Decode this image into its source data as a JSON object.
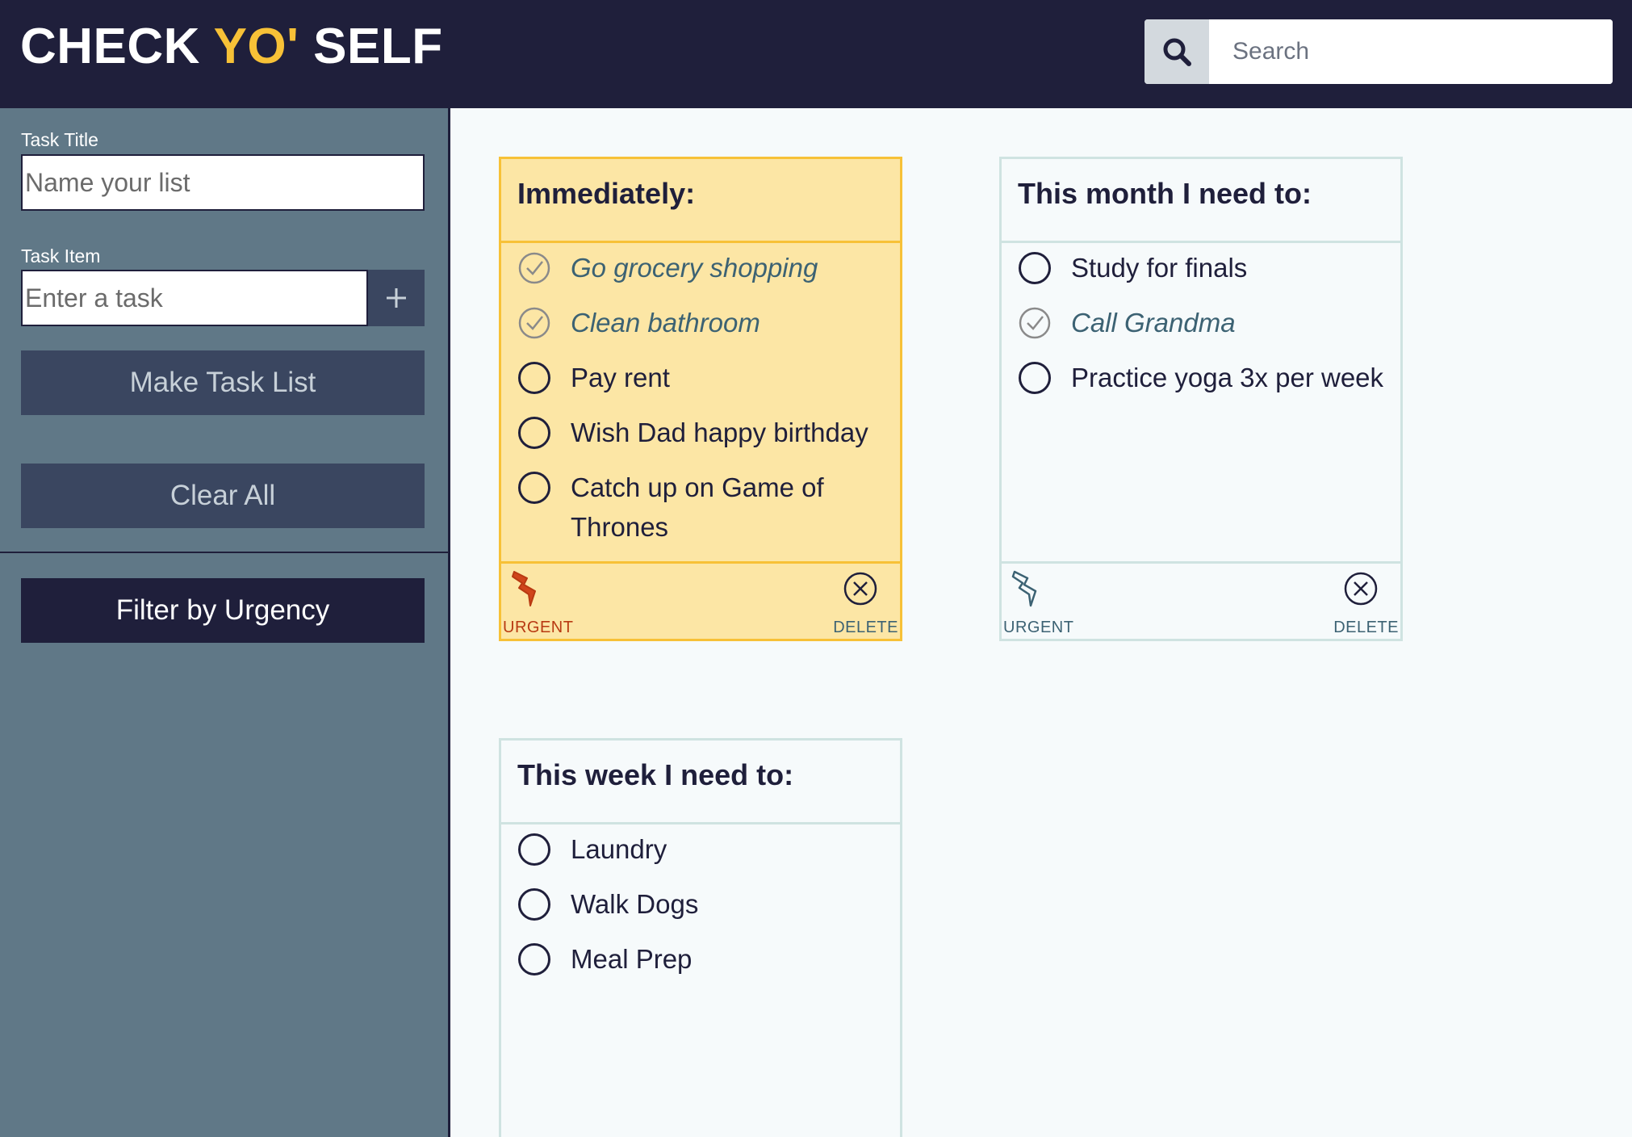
{
  "header": {
    "logo_part1": "CHECK ",
    "logo_accent": "YO'",
    "logo_part2": " SELF",
    "search_placeholder": "Search"
  },
  "sidebar": {
    "title_label": "Task Title",
    "title_placeholder": "Name your list",
    "item_label": "Task Item",
    "item_placeholder": "Enter a task",
    "make_list": "Make Task List",
    "clear_all": "Clear All",
    "filter": "Filter by Urgency"
  },
  "cards": [
    {
      "title": "Immediately:",
      "urgent": true,
      "urgent_label": "URGENT",
      "delete_label": "DELETE",
      "tasks": [
        {
          "text": "Go grocery shopping",
          "done": true
        },
        {
          "text": "Clean bathroom",
          "done": true
        },
        {
          "text": "Pay rent",
          "done": false
        },
        {
          "text": "Wish Dad happy birthday",
          "done": false
        },
        {
          "text": "Catch up on Game of Thrones",
          "done": false
        }
      ]
    },
    {
      "title": "This month I need to:",
      "urgent": false,
      "urgent_label": "URGENT",
      "delete_label": "DELETE",
      "tasks": [
        {
          "text": "Study for finals",
          "done": false
        },
        {
          "text": "Call Grandma",
          "done": true
        },
        {
          "text": "Practice yoga 3x per week",
          "done": false
        }
      ]
    },
    {
      "title": "This week I need to:",
      "urgent": false,
      "tasks": [
        {
          "text": "Laundry",
          "done": false
        },
        {
          "text": "Walk Dogs",
          "done": false
        },
        {
          "text": "Meal Prep",
          "done": false
        }
      ]
    }
  ],
  "colors": {
    "navy": "#1f1f3b",
    "accent_yellow": "#f7c137",
    "urgent_card_bg": "#fce6a5",
    "sidebar_bg": "#607887",
    "button_bg": "#3a4660",
    "urgent_red": "#b83a12"
  }
}
